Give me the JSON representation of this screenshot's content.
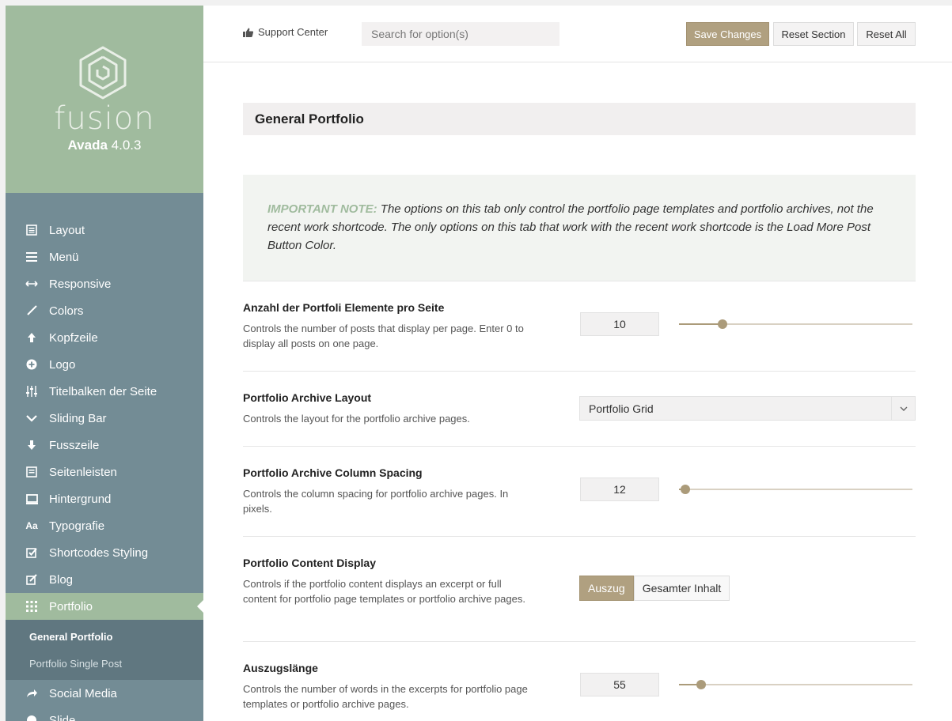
{
  "brand": {
    "logo_word": "fusion",
    "product": "Avada",
    "version": "4.0.3"
  },
  "sidebar": {
    "items": [
      {
        "label": "Layout",
        "icon": "layout-icon"
      },
      {
        "label": "Menü",
        "icon": "menu-icon"
      },
      {
        "label": "Responsive",
        "icon": "arrows-horizontal-icon"
      },
      {
        "label": "Colors",
        "icon": "brush-icon"
      },
      {
        "label": "Kopfzeile",
        "icon": "arrow-up-icon"
      },
      {
        "label": "Logo",
        "icon": "plus-circle-icon"
      },
      {
        "label": "Titelbalken der Seite",
        "icon": "sliders-icon"
      },
      {
        "label": "Sliding Bar",
        "icon": "chevron-down-icon"
      },
      {
        "label": "Fusszeile",
        "icon": "arrow-down-icon"
      },
      {
        "label": "Seitenleisten",
        "icon": "sidebar-icon"
      },
      {
        "label": "Hintergrund",
        "icon": "monitor-icon"
      },
      {
        "label": "Typografie",
        "icon": "typography-icon"
      },
      {
        "label": "Shortcodes Styling",
        "icon": "checkbox-icon"
      },
      {
        "label": "Blog",
        "icon": "edit-icon"
      },
      {
        "label": "Portfolio",
        "icon": "grid-icon"
      }
    ],
    "subitems": [
      "General Portfolio",
      "Portfolio Single Post"
    ],
    "after": [
      {
        "label": "Social Media",
        "icon": "share-icon"
      },
      {
        "label": "Slide",
        "icon": "circle-icon"
      }
    ]
  },
  "topbar": {
    "support": "Support Center",
    "search_placeholder": "Search for option(s)",
    "save": "Save Changes",
    "reset_section": "Reset Section",
    "reset_all": "Reset All"
  },
  "main": {
    "title": "General Portfolio",
    "note_label": "IMPORTANT NOTE:",
    "note_text": " The options on this tab only control the portfolio page templates and portfolio archives, not the recent work shortcode. The only options on this tab that work with the recent work shortcode is the Load More Post Button Color.",
    "options": {
      "items_per_page": {
        "label": "Anzahl der Portfoli Elemente pro Seite",
        "desc": "Controls the number of posts that display per page. Enter 0 to display all posts on one page.",
        "value": "10",
        "slider_fraction": 0.185
      },
      "archive_layout": {
        "label": "Portfolio Archive Layout",
        "desc": "Controls the layout for the portfolio archive pages.",
        "value": "Portfolio Grid"
      },
      "column_spacing": {
        "label": "Portfolio Archive Column Spacing",
        "desc": "Controls the column spacing for portfolio archive pages. In pixels.",
        "value": "12",
        "slider_fraction": 0.028
      },
      "content_display": {
        "label": "Portfolio Content Display",
        "desc": "Controls if the portfolio content displays an excerpt or full content for portfolio page templates or portfolio archive pages.",
        "option_a": "Auszug",
        "option_b": "Gesamter Inhalt",
        "selected": "Auszug"
      },
      "excerpt_length": {
        "label": "Auszugslänge",
        "desc": "Controls the number of words in the excerpts for portfolio page templates or portfolio archive pages.",
        "value": "55",
        "slider_fraction": 0.095
      }
    }
  }
}
